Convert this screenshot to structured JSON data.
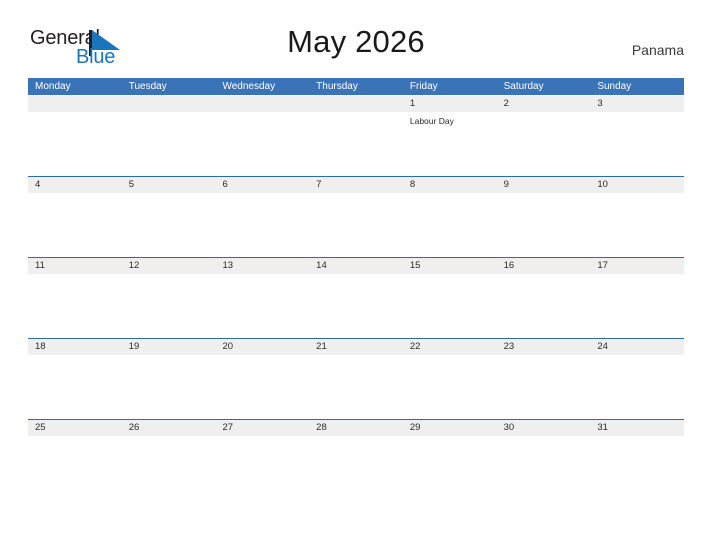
{
  "branding": {
    "logo_text_primary": "General",
    "logo_text_secondary": "Blue",
    "logo_icon": "flag-icon"
  },
  "header": {
    "title": "May 2026",
    "country": "Panama"
  },
  "theme": {
    "header_blue": "#3a74b8",
    "row_rule_blue": "#2e6da4",
    "date_band_gray": "#efefef",
    "logo_blue": "#1b75bc",
    "text_dark": "#2b2b2b"
  },
  "calendar": {
    "weekdays": [
      "Monday",
      "Tuesday",
      "Wednesday",
      "Thursday",
      "Friday",
      "Saturday",
      "Sunday"
    ],
    "weeks": [
      {
        "days": [
          {
            "date": "",
            "events": []
          },
          {
            "date": "",
            "events": []
          },
          {
            "date": "",
            "events": []
          },
          {
            "date": "",
            "events": []
          },
          {
            "date": "1",
            "events": [
              "Labour Day"
            ]
          },
          {
            "date": "2",
            "events": []
          },
          {
            "date": "3",
            "events": []
          }
        ]
      },
      {
        "days": [
          {
            "date": "4",
            "events": []
          },
          {
            "date": "5",
            "events": []
          },
          {
            "date": "6",
            "events": []
          },
          {
            "date": "7",
            "events": []
          },
          {
            "date": "8",
            "events": []
          },
          {
            "date": "9",
            "events": []
          },
          {
            "date": "10",
            "events": []
          }
        ]
      },
      {
        "days": [
          {
            "date": "11",
            "events": []
          },
          {
            "date": "12",
            "events": []
          },
          {
            "date": "13",
            "events": []
          },
          {
            "date": "14",
            "events": []
          },
          {
            "date": "15",
            "events": []
          },
          {
            "date": "16",
            "events": []
          },
          {
            "date": "17",
            "events": []
          }
        ]
      },
      {
        "days": [
          {
            "date": "18",
            "events": []
          },
          {
            "date": "19",
            "events": []
          },
          {
            "date": "20",
            "events": []
          },
          {
            "date": "21",
            "events": []
          },
          {
            "date": "22",
            "events": []
          },
          {
            "date": "23",
            "events": []
          },
          {
            "date": "24",
            "events": []
          }
        ]
      },
      {
        "days": [
          {
            "date": "25",
            "events": []
          },
          {
            "date": "26",
            "events": []
          },
          {
            "date": "27",
            "events": []
          },
          {
            "date": "28",
            "events": []
          },
          {
            "date": "29",
            "events": []
          },
          {
            "date": "30",
            "events": []
          },
          {
            "date": "31",
            "events": []
          }
        ]
      }
    ]
  }
}
